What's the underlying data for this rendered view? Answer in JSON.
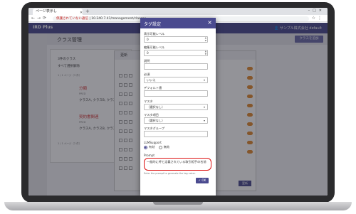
{
  "browser": {
    "tab_title": "ページ表示し",
    "url_warning": "保護されていない通信",
    "url_text": "10.240.7.41/management/classes"
  },
  "app": {
    "brand": "IRD Plus",
    "user": "サンプル株式会社 default"
  },
  "background_page": {
    "title": "クラス管理",
    "add_button": "クラスを追加",
    "panel_count": "3件のクラス",
    "panel_delete_all": "すべて選択解除",
    "panel_paging_top": "1 / 1 ページ（3 件）",
    "item1_title": "分類",
    "item1_tag": "PRED",
    "item1_sub": "クラスA, クラスB, クラスC",
    "item2_title": "契約書関連",
    "item2_tag": "PRED",
    "item2_sub": "クラスA, クラスB, クラスC",
    "panel_paging_bottom": "1 / 1 ページ（2 件）",
    "middle_dialog_title": "更新",
    "middle_ok": "更新"
  },
  "dialog": {
    "title": "タグ設定",
    "close_icon": "close-icon",
    "fields": {
      "display_level_label": "表示可能レベル",
      "display_level_value": "0",
      "edit_level_label": "編集可能レベル",
      "edit_level_value": "0",
      "desc_label": "説明",
      "desc_value": "",
      "required_label": "必須",
      "required_value": "いいえ",
      "default_label": "デフォルト値",
      "default_value": "",
      "master_label": "マスタ",
      "master_value": "（選択なし）",
      "master_project_label": "マスタ項目",
      "master_project_value": "（選択なし）",
      "master_group_label": "マスタグループ",
      "master_group_value": "",
      "llm_label": "LLMSupport",
      "llm_on": "有効",
      "llm_off": "無効",
      "prompt_label": "Prompt",
      "prompt_value": "一般的に呼と定義されている取引相手の名前",
      "prompt_hint": "Enter the prompt to generate the tag value.",
      "ok": "OK"
    }
  }
}
